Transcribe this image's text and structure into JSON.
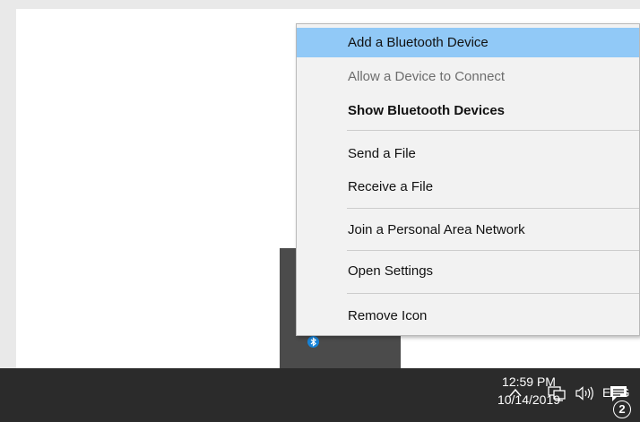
{
  "context_menu": {
    "items": [
      {
        "label": "Add a Bluetooth Device"
      },
      {
        "label": "Allow a Device to Connect"
      },
      {
        "label": "Show Bluetooth Devices"
      },
      {
        "label": "Send a File"
      },
      {
        "label": "Receive a File"
      },
      {
        "label": "Join a Personal Area Network"
      },
      {
        "label": "Open Settings"
      },
      {
        "label": "Remove Icon"
      }
    ]
  },
  "taskbar": {
    "language": "ENG",
    "time": "12:59 PM",
    "date": "10/14/2019",
    "notification_count": "2",
    "icons": [
      "chevron-up-icon",
      "network-icon",
      "volume-icon",
      "action-center-icon",
      "bluetooth-icon"
    ]
  },
  "colors": {
    "menu_highlight": "#91c9f7",
    "menu_background": "#f2f2f2",
    "taskbar_background": "#2b2b2b",
    "bluetooth_blue": "#1683d8"
  }
}
